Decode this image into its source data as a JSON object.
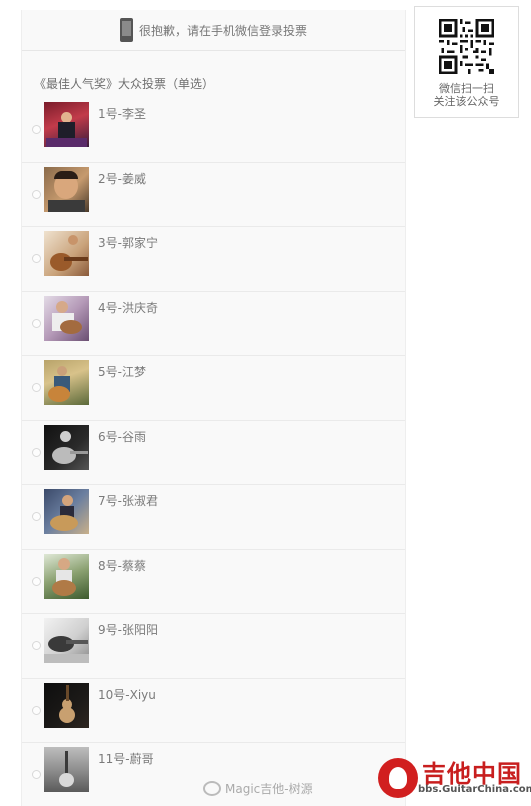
{
  "notice": {
    "text": "很抱歉，请在手机微信登录投票"
  },
  "poll": {
    "title": "《最佳人气奖》大众投票（单选）",
    "options": [
      {
        "label": "1号-李圣",
        "photo": "stage-red"
      },
      {
        "label": "2号-姜威",
        "photo": "portrait-warm"
      },
      {
        "label": "3号-郭家宁",
        "photo": "guitar-warm"
      },
      {
        "label": "4号-洪庆奇",
        "photo": "portrait-purple"
      },
      {
        "label": "5号-江梦",
        "photo": "guitar-outdoor"
      },
      {
        "label": "6号-谷雨",
        "photo": "guitar-dark"
      },
      {
        "label": "7号-张淑君",
        "photo": "guitar-blue"
      },
      {
        "label": "8号-蔡蔡",
        "photo": "guitar-green"
      },
      {
        "label": "9号-张阳阳",
        "photo": "guitar-bw"
      },
      {
        "label": "10号-Xiyu",
        "photo": "guitar-black"
      },
      {
        "label": "11号-蔚哥",
        "photo": "guitar-grey"
      }
    ]
  },
  "qr": {
    "line1": "微信扫一扫",
    "line2": "关注该公众号"
  },
  "watermark": {
    "weibo": "Magic吉他-树源",
    "logo_cn": "吉他中国",
    "logo_url": "bbs.GuitarChina.com"
  }
}
